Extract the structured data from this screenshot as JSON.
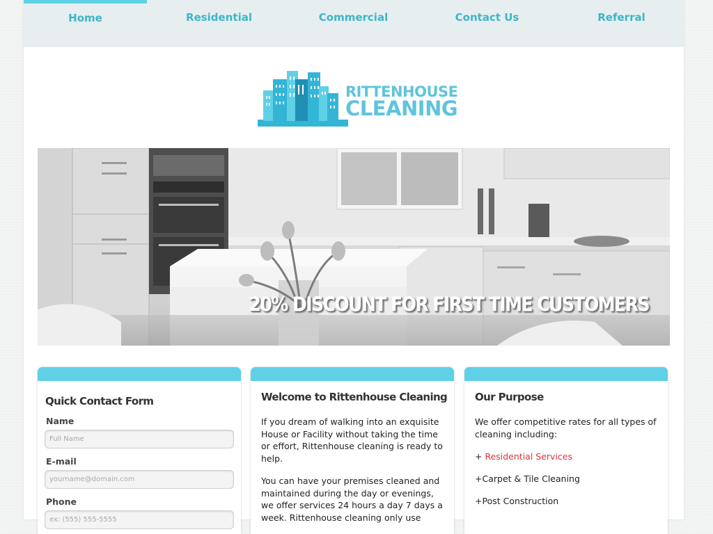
{
  "nav": {
    "items": [
      {
        "label": "Home",
        "active": true
      },
      {
        "label": "Residential"
      },
      {
        "label": "Commercial"
      },
      {
        "label": "Contact Us"
      },
      {
        "label": "Referral"
      }
    ]
  },
  "logo": {
    "line1": "RITTENHOUSE",
    "line2": "CLEANING",
    "colors": {
      "light": "#5fd0e6",
      "mid": "#33b5d6",
      "dark": "#1f8fb3"
    }
  },
  "hero": {
    "banner": "20% DISCOUNT FOR FIRST TIME CUSTOMERS"
  },
  "contact_form": {
    "title": "Quick Contact Form",
    "name_label": "Name",
    "name_placeholder": "Full Name",
    "email_label": "E-mail",
    "email_placeholder": "yourname@domain.com",
    "phone_label": "Phone",
    "phone_placeholder": "ex: (555) 555-5555"
  },
  "welcome": {
    "title": "Welcome to Rittenhouse Cleaning",
    "para1": "If you dream of walking into an exquisite House or Facility without taking the time or effort, Rittenhouse cleaning is ready to help.",
    "para2": "You can have your premises cleaned and maintained during the day or evenings, we offer services 24 hours a day 7 days a week. Rittenhouse cleaning only use"
  },
  "purpose": {
    "title": "Our Purpose",
    "intro": "We offer competitive rates for all types of cleaning including:",
    "items": [
      {
        "prefix": "+ ",
        "label": "Residential Services",
        "link": true
      },
      {
        "prefix": "+",
        "label": "Carpet & Tile Cleaning"
      },
      {
        "prefix": "+",
        "label": "Post Construction"
      }
    ]
  },
  "colors": {
    "accent": "#5fd0e6",
    "nav_text": "#3eb6c6",
    "link": "#e0313e"
  }
}
